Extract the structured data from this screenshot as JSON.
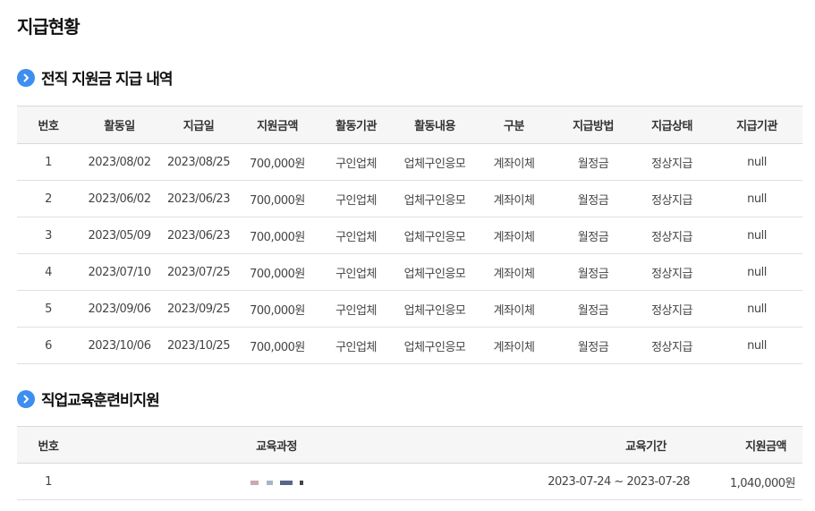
{
  "page_title": "지급현황",
  "section1": {
    "title": "전직 지원금 지급 내역",
    "columns": [
      "번호",
      "활동일",
      "지급일",
      "지원금액",
      "활동기관",
      "활동내용",
      "구분",
      "지급방법",
      "지급상태",
      "지급기관"
    ],
    "rows": [
      [
        "1",
        "2023/08/02",
        "2023/08/25",
        "700,000원",
        "구인업체",
        "업체구인응모",
        "계좌이체",
        "월정금",
        "정상지급",
        "null"
      ],
      [
        "2",
        "2023/06/02",
        "2023/06/23",
        "700,000원",
        "구인업체",
        "업체구인응모",
        "계좌이체",
        "월정금",
        "정상지급",
        "null"
      ],
      [
        "3",
        "2023/05/09",
        "2023/06/23",
        "700,000원",
        "구인업체",
        "업체구인응모",
        "계좌이체",
        "월정금",
        "정상지급",
        "null"
      ],
      [
        "4",
        "2023/07/10",
        "2023/07/25",
        "700,000원",
        "구인업체",
        "업체구인응모",
        "계좌이체",
        "월정금",
        "정상지급",
        "null"
      ],
      [
        "5",
        "2023/09/06",
        "2023/09/25",
        "700,000원",
        "구인업체",
        "업체구인응모",
        "계좌이체",
        "월정금",
        "정상지급",
        "null"
      ],
      [
        "6",
        "2023/10/06",
        "2023/10/25",
        "700,000원",
        "구인업체",
        "업체구인응모",
        "계좌이체",
        "월정금",
        "정상지급",
        "null"
      ]
    ]
  },
  "section2": {
    "title": "직업교육훈련비지원",
    "columns": [
      "번호",
      "교육과정",
      "교육기간",
      "지원금액"
    ],
    "rows": [
      [
        "1",
        "",
        "2023-07-24 ~ 2023-07-28",
        "1,040,000원"
      ]
    ]
  },
  "colors": {
    "accent": "#3d8ef0",
    "header_bg": "#f6f6f6"
  },
  "icons": {
    "section_bullet": "chevron-right-circle-icon"
  }
}
